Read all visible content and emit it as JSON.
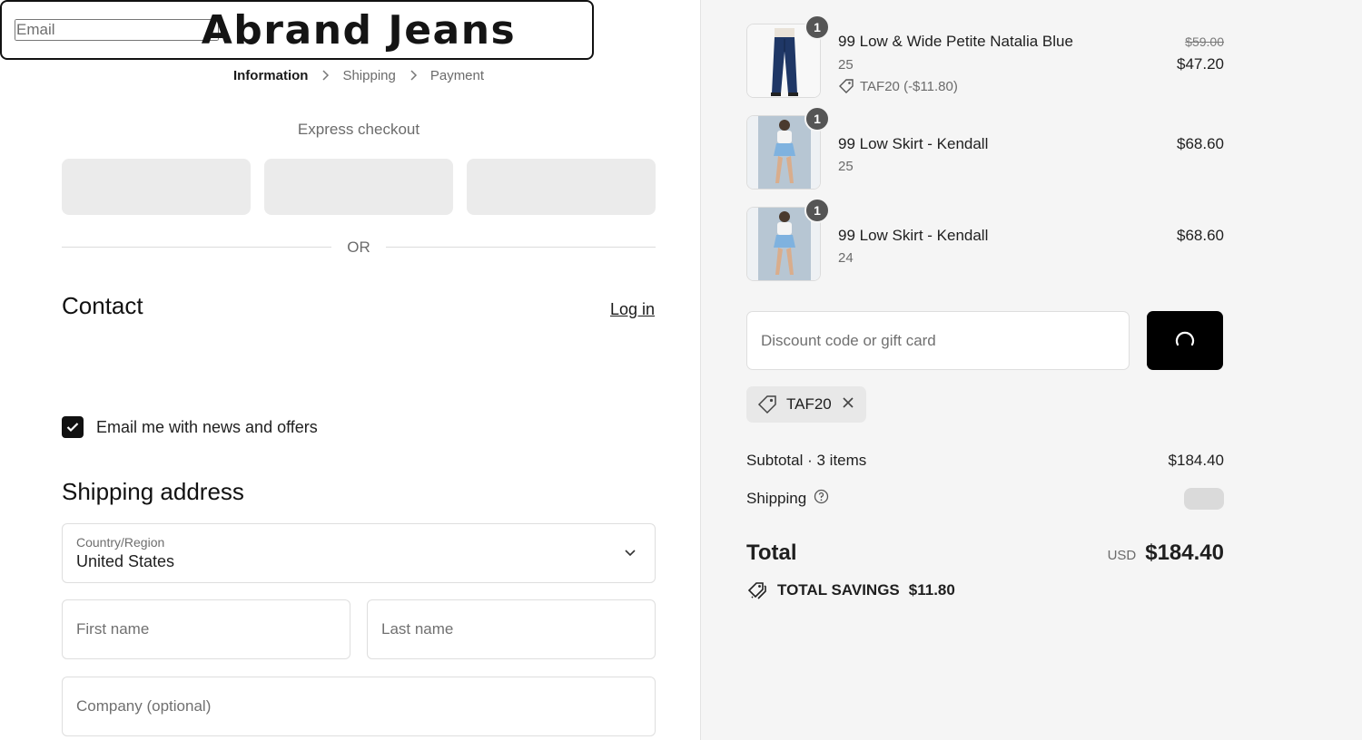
{
  "brand": "Abrand Jeans",
  "breadcrumbs": [
    "Information",
    "Shipping",
    "Payment"
  ],
  "express_checkout_label": "Express checkout",
  "or_label": "OR",
  "contact": {
    "heading": "Contact",
    "login_label": "Log in",
    "email_placeholder": "Email",
    "newsletter_label": "Email me with news and offers",
    "newsletter_checked": true
  },
  "shipping_address": {
    "heading": "Shipping address",
    "country_label": "Country/Region",
    "country_value": "United States",
    "first_name_placeholder": "First name",
    "last_name_placeholder": "Last name",
    "company_placeholder": "Company (optional)"
  },
  "cart": {
    "items": [
      {
        "quantity": "1",
        "name": "99 Low & Wide Petite Natalia Blue",
        "variant": "25",
        "discount": "TAF20 (-$11.80)",
        "original_price": "$59.00",
        "price": "$47.20",
        "image": "jeans"
      },
      {
        "quantity": "1",
        "name": "99 Low Skirt - Kendall",
        "variant": "25",
        "price": "$68.60",
        "image": "skirt"
      },
      {
        "quantity": "1",
        "name": "99 Low Skirt - Kendall",
        "variant": "24",
        "price": "$68.60",
        "image": "skirt"
      }
    ],
    "discount_placeholder": "Discount code or gift card",
    "applied_code": "TAF20",
    "subtotal_label": "Subtotal · 3 items",
    "subtotal_value": "$184.40",
    "shipping_label": "Shipping",
    "total_label": "Total",
    "currency": "USD",
    "total_value": "$184.40",
    "savings_label": "TOTAL SAVINGS",
    "savings_value": "$11.80"
  },
  "colors": {
    "primary_button": "#000000",
    "summary_background": "#f5f5f5",
    "placeholder_button": "#ebebeb",
    "quantity_badge": "#555555"
  }
}
